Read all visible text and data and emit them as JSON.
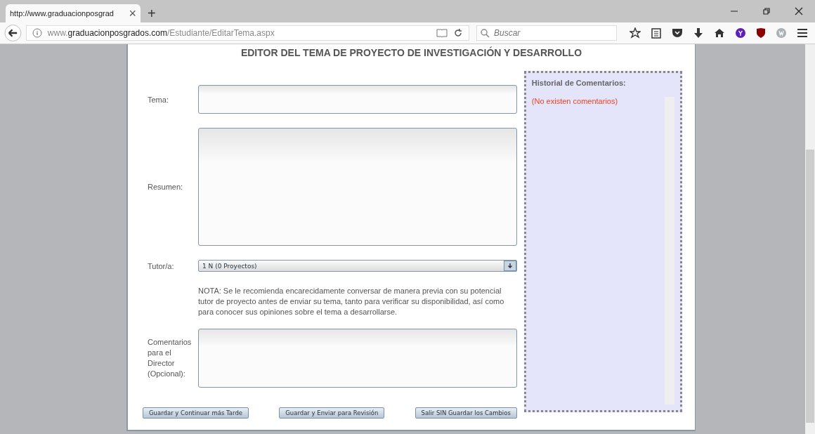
{
  "browser": {
    "tab": {
      "title": "http://www.graduacionposgrad",
      "close": "×",
      "selected": true
    },
    "new_tab": "+",
    "url": {
      "prefix": "www.",
      "host": "graduacionposgrados.com",
      "path": "/Estudiante/EditarTema.aspx"
    },
    "search": {
      "placeholder": "Buscar"
    }
  },
  "page": {
    "title": "EDITOR DEL TEMA DE PROYECTO DE INVESTIGACIÓN Y DESARROLLO",
    "fields": [
      {
        "kind": "input",
        "label": "Tema:"
      },
      {
        "kind": "textarea",
        "label": "Resumen:"
      },
      {
        "kind": "select",
        "label": "Tutor/a:",
        "value": "1 N (0 Proyectos)"
      },
      {
        "kind": "note",
        "text": "NOTA: Se le recomienda encarecidamente conversar de manera previa con su potencial tutor de proyecto antes de enviar su tema, tanto para verificar su disponibilidad, así como para conocer sus opiniones sobre el tema a desarrollarse."
      },
      {
        "kind": "comments",
        "label": "Comentarios para el Director (Opcional):"
      }
    ],
    "buttons": [
      "Guardar y Continuar más Tarde",
      "Guardar y Enviar para Revisión",
      "Salir SIN Guardar los Cambios"
    ],
    "history": {
      "title": "Historial de Comentarios:",
      "empty": "(No existen comentarios)"
    }
  }
}
